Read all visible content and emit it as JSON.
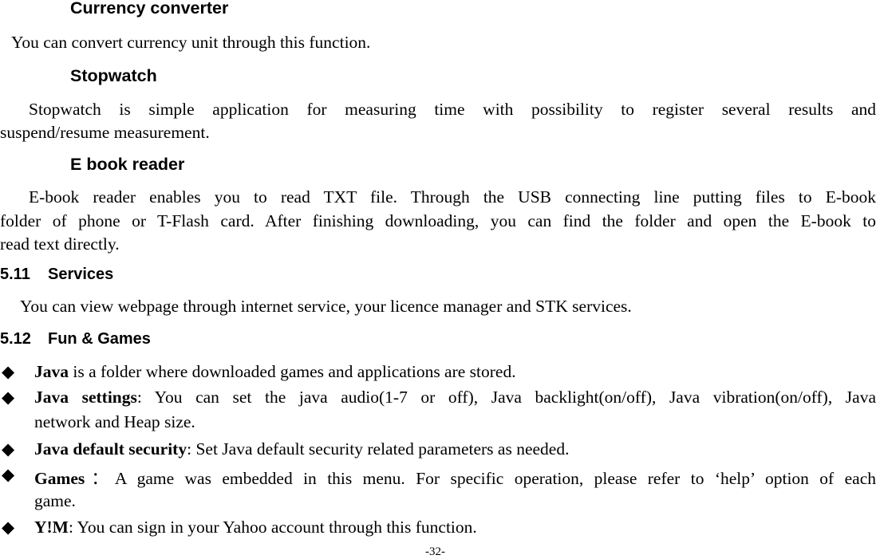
{
  "currency": {
    "heading": "Currency converter",
    "body": "You can convert currency unit through this function."
  },
  "stopwatch": {
    "heading": "Stopwatch",
    "line1": "Stopwatch is simple application for measuring time with possibility to register several results and",
    "line2": "suspend/resume measurement."
  },
  "ebook": {
    "heading": "E book reader",
    "line1": "E-book reader enables you to read TXT file. Through the USB connecting line putting files to E-book",
    "line2": "folder of phone or T-Flash card. After finishing downloading, you can find the folder and open the E-book to",
    "line3": "read text directly."
  },
  "services": {
    "number": "5.11",
    "title": "Services",
    "body": "You can view webpage through internet service, your licence manager and STK services."
  },
  "fun_games": {
    "number": "5.12",
    "title": "Fun & Games",
    "bullet_glyph": "◆",
    "items": [
      {
        "term": "Java",
        "text": " is a folder where downloaded games and applications are stored."
      },
      {
        "term": "Java settings",
        "text": ": You can set the java audio(1-7 or off), Java backlight(on/off), Java vibration(on/off), Java",
        "text2": "network and Heap size."
      },
      {
        "term": "Java default security",
        "text": ": Set Java default security related parameters as needed."
      },
      {
        "term": "Games",
        "text": "：A game was embedded in this menu. For specific operation, please refer to ‘help’ option of each",
        "text2": "game."
      },
      {
        "term": "Y!M",
        "text": ": You can sign in your Yahoo account through this function."
      }
    ]
  },
  "footer": {
    "page_number": "-32-"
  }
}
